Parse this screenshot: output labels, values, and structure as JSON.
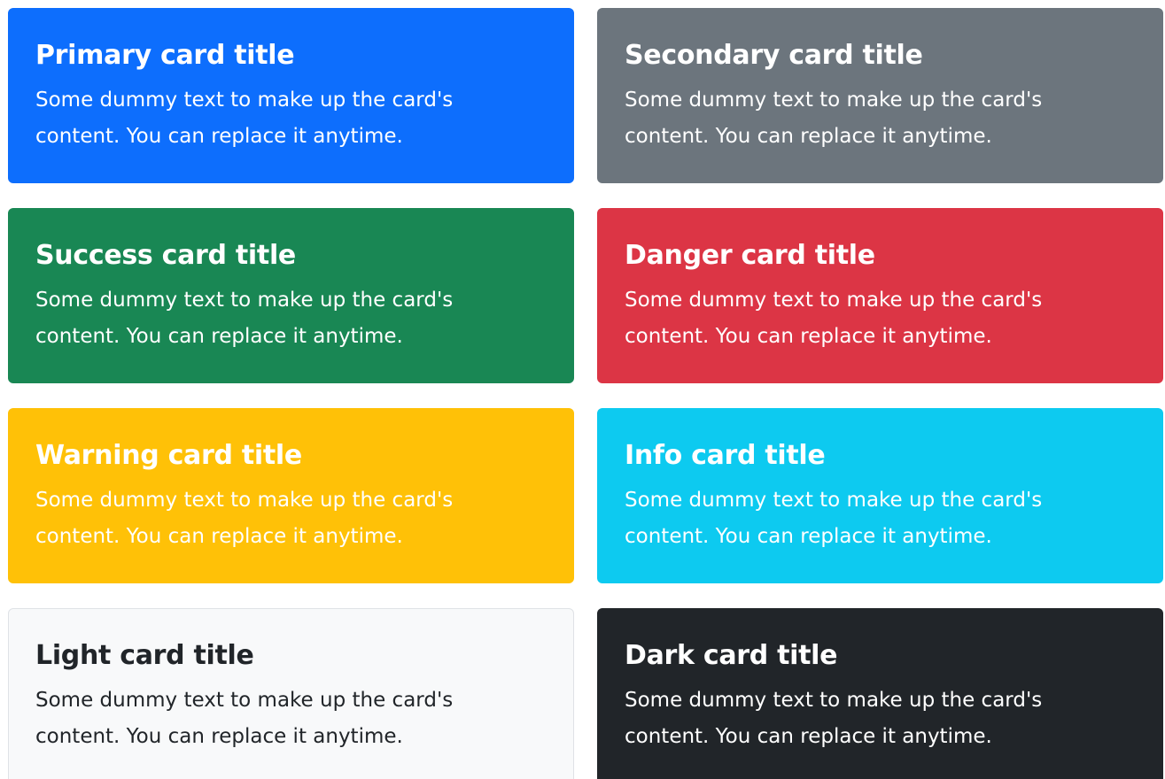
{
  "cards": [
    {
      "title": "Primary card title",
      "text": "Some dummy text to make up the card's content. You can replace it anytime.",
      "bg": "#0d6efd",
      "fg": "#ffffff"
    },
    {
      "title": "Secondary card title",
      "text": "Some dummy text to make up the card's content. You can replace it anytime.",
      "bg": "#6c757d",
      "fg": "#ffffff"
    },
    {
      "title": "Success card title",
      "text": "Some dummy text to make up the card's content. You can replace it anytime.",
      "bg": "#198754",
      "fg": "#ffffff"
    },
    {
      "title": "Danger card title",
      "text": "Some dummy text to make up the card's content. You can replace it anytime.",
      "bg": "#dc3545",
      "fg": "#ffffff"
    },
    {
      "title": "Warning card title",
      "text": "Some dummy text to make up the card's content. You can replace it anytime.",
      "bg": "#ffc107",
      "fg": "#ffffff"
    },
    {
      "title": "Info card title",
      "text": "Some dummy text to make up the card's content. You can replace it anytime.",
      "bg": "#0dcaf0",
      "fg": "#ffffff"
    },
    {
      "title": "Light card title",
      "text": "Some dummy text to make up the card's content. You can replace it anytime.",
      "bg": "#f8f9fa",
      "fg": "#212529"
    },
    {
      "title": "Dark card title",
      "text": "Some dummy text to make up the card's content. You can replace it anytime.",
      "bg": "#212529",
      "fg": "#ffffff"
    }
  ]
}
